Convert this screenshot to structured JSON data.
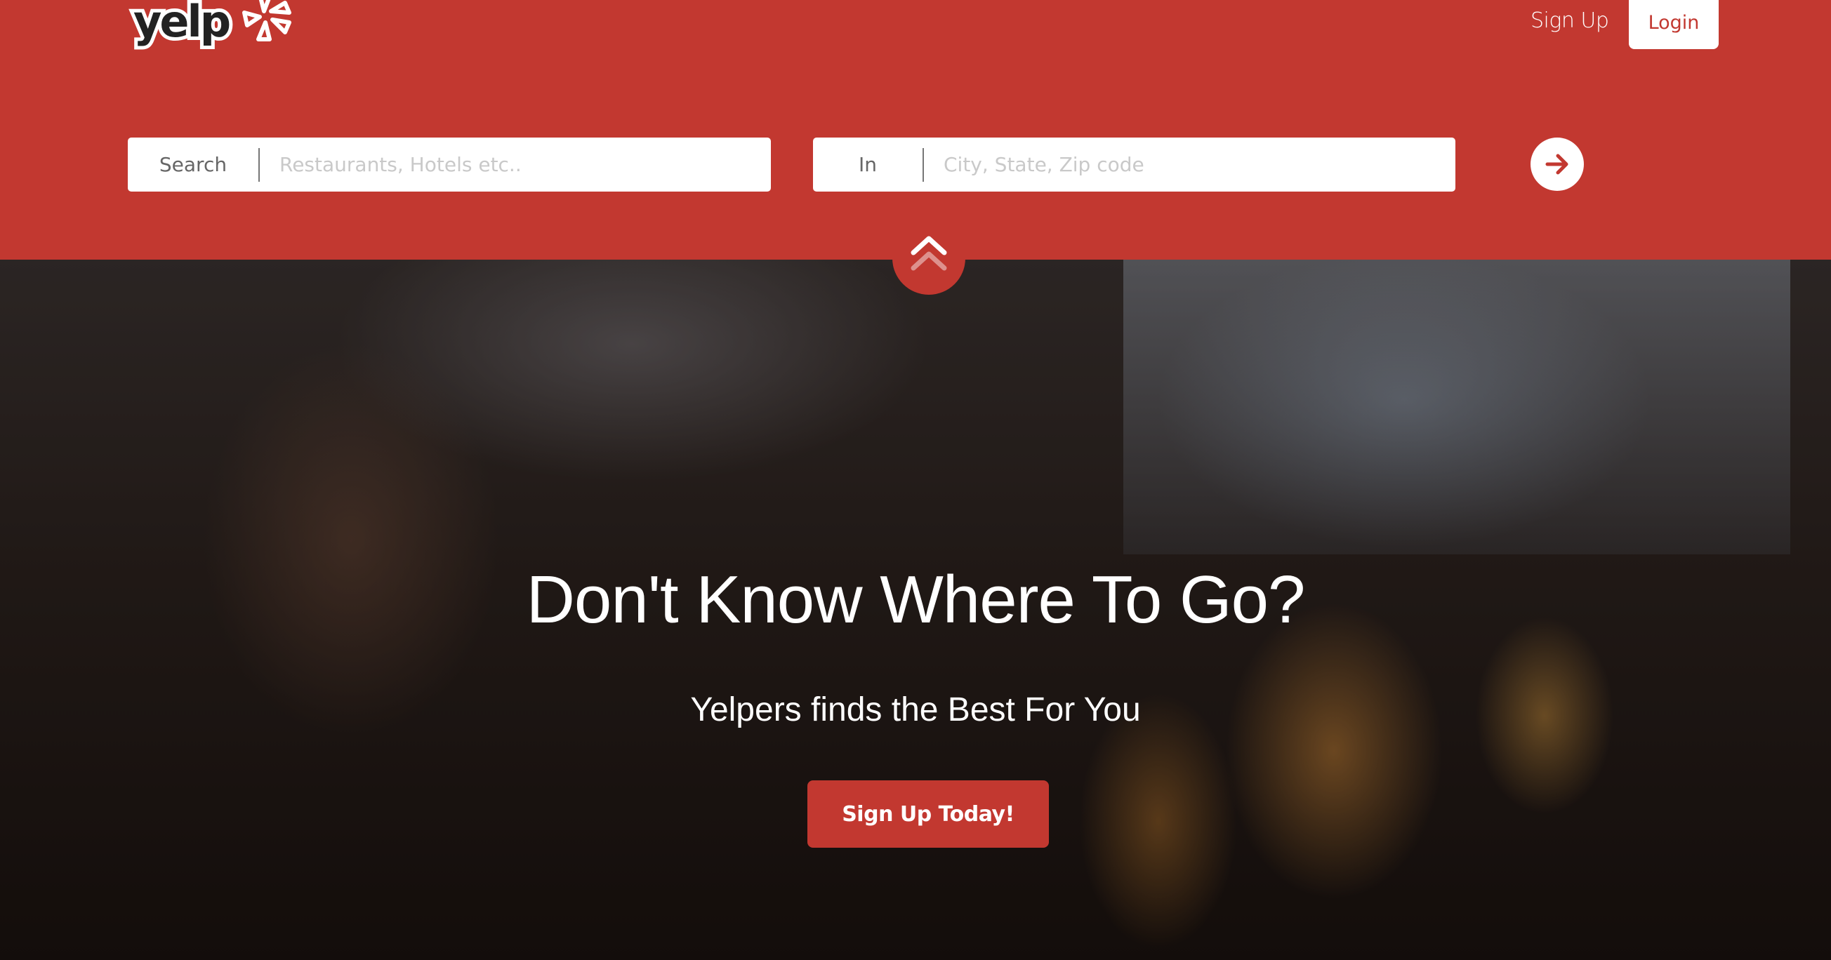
{
  "header": {
    "logo_text": "yelp",
    "nav": {
      "signup_label": "Sign Up",
      "login_label": "Login"
    },
    "search": {
      "what_label": "Search",
      "what_placeholder": "Restaurants, Hotels etc..",
      "what_value": "",
      "where_label": "In",
      "where_placeholder": "City, State, Zip code",
      "where_value": "",
      "go_icon": "arrow-right-icon"
    },
    "scroll_icon": "double-chevron-up-icon"
  },
  "hero": {
    "title": "Don't Know Where To Go?",
    "subtitle": "Yelpers finds the Best For You",
    "cta_label": "Sign Up Today!"
  },
  "colors": {
    "brand_red": "#c23830",
    "white": "#ffffff",
    "placeholder_gray": "#c9c9c9",
    "label_gray": "#666666"
  }
}
